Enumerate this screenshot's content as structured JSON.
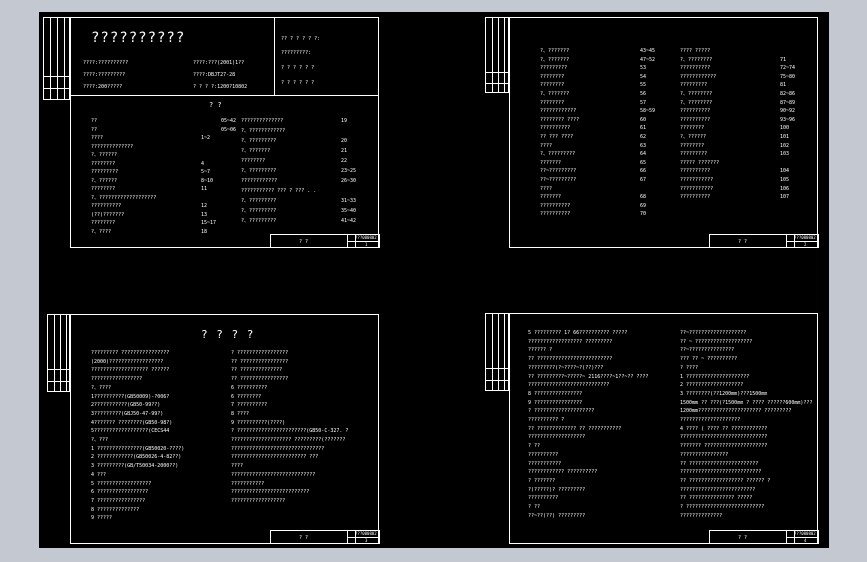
{
  "ui": {
    "background": "#c3c8d1",
    "canvas_color": "#000000",
    "line_color": "#ffffff"
  },
  "sheet1": {
    "title": "??????????",
    "info_left": [
      "????:??????????",
      "????:?????????",
      "????:200?????"
    ],
    "info_right": [
      "????:???(2001)1??",
      "????:DBJT27-28",
      "? ? ? ?:1200?10802"
    ],
    "info_box": [
      "?? ? ? ? ? ?:",
      "?????????:",
      "? ? ? ? ? ?",
      "? ? ? ? ? ?"
    ],
    "heading": "?      ?",
    "col1": [
      {
        "t": "??",
        "n": ""
      },
      {
        "t": "??",
        "n": ""
      },
      {
        "t": "????",
        "n": "1~2"
      },
      {
        "t": "??????????????",
        "n": ""
      },
      {
        "t": "?、??????",
        "n": ""
      },
      {
        "t": "????????",
        "n": "4"
      },
      {
        "t": "?????????",
        "n": "5~7"
      },
      {
        "t": "?、??????",
        "n": "8~10"
      },
      {
        "t": "????????",
        "n": "11"
      },
      {
        "t": "?、???????????????????",
        "n": ""
      },
      {
        "t": "??????????",
        "n": "12"
      },
      {
        "t": "(??)???????",
        "n": "13"
      },
      {
        "t": "????????",
        "n": "15~17"
      },
      {
        "t": "?、????",
        "n": "18"
      }
    ],
    "col2": [
      {
        "t": "??????????????",
        "n": "19"
      },
      {
        "t": "?、????????????",
        "n": ""
      },
      {
        "t": "?、?????????",
        "n": "20"
      },
      {
        "t": "?、???????",
        "n": "21"
      },
      {
        "t": "????????",
        "n": "22"
      },
      {
        "t": "?、?????????",
        "n": "23~25"
      },
      {
        "t": "????????????",
        "n": "26~30"
      },
      {
        "t": "??????????? ??? ? ??? . .",
        "n": ""
      },
      {
        "t": "?、?????????",
        "n": "31~33"
      },
      {
        "t": "?、?????????",
        "n": "35~40"
      },
      {
        "t": "?、?????????",
        "n": "41~42"
      }
    ],
    "col2_prefix": [
      "05~42",
      "05~06"
    ],
    "titleblock": {
      "name": "?   ?",
      "code": "???080802",
      "page": "1"
    }
  },
  "sheet2": {
    "col1": [
      {
        "t": "?、???????",
        "n": "43~45"
      },
      {
        "t": "?、???????",
        "n": "47~52"
      },
      {
        "t": "?????????",
        "n": "53"
      },
      {
        "t": "????????",
        "n": "54"
      },
      {
        "t": "????????",
        "n": "55"
      },
      {
        "t": "?、???????",
        "n": "56"
      },
      {
        "t": "????????",
        "n": "57"
      },
      {
        "t": "????????????",
        "n": "58~59"
      },
      {
        "t": "???????? ????",
        "n": "60"
      },
      {
        "t": "??????????",
        "n": "61"
      },
      {
        "t": "?? ??? ????",
        "n": "62"
      },
      {
        "t": "????",
        "n": "63"
      },
      {
        "t": "?、?????????",
        "n": "64"
      },
      {
        "t": "???????",
        "n": "65"
      },
      {
        "t": "??~?????????",
        "n": "66"
      },
      {
        "t": "??~?????????",
        "n": "67"
      },
      {
        "t": "????",
        "n": ""
      },
      {
        "t": "???????",
        "n": "68"
      },
      {
        "t": "??????????",
        "n": "69"
      },
      {
        "t": "??????????",
        "n": "70"
      }
    ],
    "col2": [
      {
        "t": "????  ?????",
        "n": ""
      },
      {
        "t": "?、????????",
        "n": "71"
      },
      {
        "t": "??????????",
        "n": "72~74"
      },
      {
        "t": "????????????",
        "n": "75~80"
      },
      {
        "t": "?????????",
        "n": "81"
      },
      {
        "t": "?、????????",
        "n": "82~86"
      },
      {
        "t": "?、????????",
        "n": "87~89"
      },
      {
        "t": "??????????",
        "n": "90~92"
      },
      {
        "t": "??????????",
        "n": "93~96"
      },
      {
        "t": "????????",
        "n": "100"
      },
      {
        "t": "?、??????",
        "n": "101"
      },
      {
        "t": "????????",
        "n": "102"
      },
      {
        "t": "?????????",
        "n": "103"
      },
      {
        "t": "?????  ???????",
        "n": ""
      },
      {
        "t": "??????????",
        "n": "104"
      },
      {
        "t": "???????????",
        "n": "105"
      },
      {
        "t": "???????????",
        "n": "106"
      },
      {
        "t": "??????????",
        "n": "107"
      }
    ],
    "titleblock": {
      "name": "?   ?",
      "code": "???080802",
      "page": "2"
    }
  },
  "sheet3": {
    "title": "? ? ? ?",
    "left": [
      "????????? ????????????????",
      "(2000)??????????????????",
      "??????????????????? ??????",
      "?????????????????",
      "?、????",
      "1??????????(GB50009)-?006?",
      "2???????????(GB50-99??)",
      "3?????????(GBJ50-47-99?)",
      "4???????   ????????(GB50-98?)",
      "5??????????????????(CECS44",
      "?、???",
      "1  ???????????????(GB50020-????)",
      "2  ????????????(GB50026-4-82??)",
      "3  ?????????(GB/T50034-2000??)",
      "4  ???",
      "5  ??????????????????",
      "6  ?????????????????",
      "7  ????????????????",
      "8  ??????????????",
      "9  ?????"
    ],
    "right": [
      "?  ?????????????????",
      "??  ????????????????",
      "??  ??????????????",
      "??  ????????????????",
      "6  ??????????",
      "6  ????????",
      "7  ??????????",
      "8  ????",
      "9  ??????????(????)",
      "?  ???????????????????????(GB50-C-327.  ?",
      "????????????????????    ?????????(???????",
      "???????????????????????????????",
      "?????????????????????????     ???",
      "????",
      "????????????????????????????",
      "???????????",
      "??????????????????????????",
      "??????????????????"
    ],
    "titleblock": {
      "name": "?   ?",
      "code": "???080802",
      "page": "3"
    }
  },
  "sheet4": {
    "left": [
      "5  ????????? 1? 66?????????? ?????",
      "?????????????????? ?????????",
      "?????? ?",
      "??  ?????????????????????????",
      "?????????(?~????~?(??)???",
      "??  ?????????~?????~ 2116????~1??~?? ????",
      "???????????????????????????",
      "8  ????????????????",
      "9  ????????????????",
      "?  ????????????????????",
      "??????????        ?",
      "??  ????????????? ?? ???????????",
      "???????????????????",
      "?  ??",
      "??????????",
      "???????????",
      "????????????    ??????????",
      "?  ???????",
      "?(?????)? ?????????",
      "??????????",
      "?  ??",
      "??~??(??)  ?????????"
    ],
    "right": [
      "??~???????????????????",
      "??  ~ ???????????????????",
      "??~???????????????",
      "???  ?? ~ ??????????",
      "?  ????",
      "1  ?????????????????????",
      "2  ???????????????????",
      "3  ????????(??1200mm)???1500mm",
      "1500mm ??   ???(?1500mm ?  ????  ??????600mm)???",
      "1200mm????????????????????? ?????????",
      "????????????????????",
      "4  ???? ( ???? ?? ????????????",
      "?????????????????????????????",
      "???????    ?????????????????????",
      "????????????????",
      "??  ???????????????????????",
      "???????????????????????????",
      "??  ?????????????????? ??????      ?",
      "?????????????????????????",
      "??   ??????????????? ?????",
      "?  ??????????????????????????",
      "??????????????"
    ],
    "titleblock": {
      "name": "?   ?",
      "code": "???080802",
      "page": "4"
    }
  }
}
